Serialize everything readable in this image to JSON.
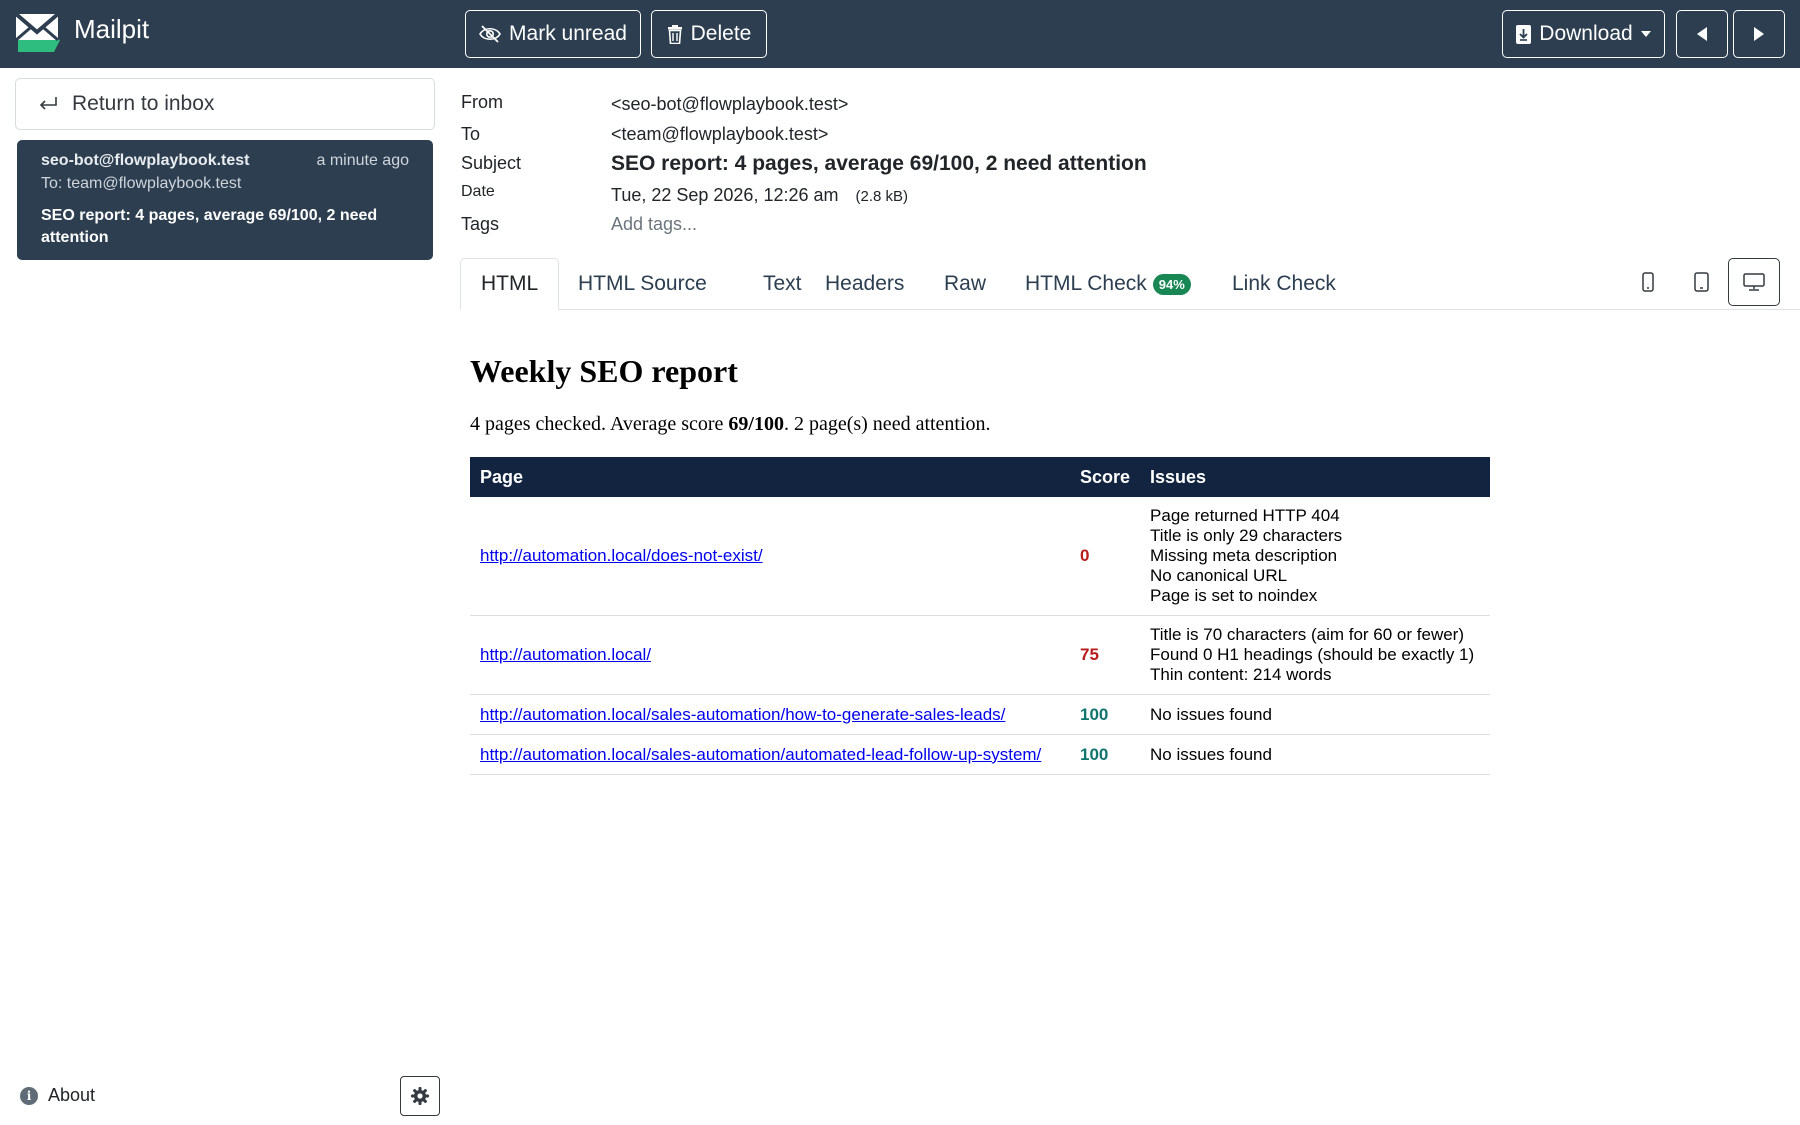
{
  "app": {
    "name": "Mailpit"
  },
  "toolbar": {
    "mark_unread": "Mark unread",
    "delete": "Delete",
    "download": "Download"
  },
  "sidebar": {
    "return_label": "Return to inbox",
    "message": {
      "from": "seo-bot@flowplaybook.test",
      "time": "a minute ago",
      "to": "To: team@flowplaybook.test",
      "subject": "SEO report: 4 pages, average 69/100, 2 need attention"
    },
    "about": "About"
  },
  "headers": {
    "from_label": "From",
    "from_value": "<seo-bot@flowplaybook.test>",
    "to_label": "To",
    "to_value": "<team@flowplaybook.test>",
    "subject_label": "Subject",
    "subject_value": "SEO report: 4 pages, average 69/100, 2 need attention",
    "date_label": "Date",
    "date_value": "Tue, 22 Sep 2026, 12:26 am",
    "size": "(2.8 kB)",
    "tags_label": "Tags",
    "tags_placeholder": "Add tags..."
  },
  "tabs": [
    {
      "label": "HTML"
    },
    {
      "label": "HTML Source"
    },
    {
      "label": "Text"
    },
    {
      "label": "Headers"
    },
    {
      "label": "Raw"
    },
    {
      "label": "HTML Check",
      "badge": "94%"
    },
    {
      "label": "Link Check"
    }
  ],
  "email": {
    "title": "Weekly SEO report",
    "summary_pre": "4 pages checked. Average score ",
    "summary_score": "69/100",
    "summary_post": ". 2 page(s) need attention.",
    "columns": [
      "Page",
      "Score",
      "Issues"
    ],
    "rows": [
      {
        "url": "http://automation.local/does-not-exist/",
        "score": "0",
        "score_color": "#b91c1c",
        "issues": [
          "Page returned HTTP 404",
          "Title is only 29 characters",
          "Missing meta description",
          "No canonical URL",
          "Page is set to noindex"
        ]
      },
      {
        "url": "http://automation.local/",
        "score": "75",
        "score_color": "#b91c1c",
        "issues": [
          "Title is 70 characters (aim for 60 or fewer)",
          "Found 0 H1 headings (should be exactly 1)",
          "Thin content: 214 words"
        ]
      },
      {
        "url": "http://automation.local/sales-automation/how-to-generate-sales-leads/",
        "score": "100",
        "score_color": "#0f766e",
        "issues": [
          "No issues found"
        ]
      },
      {
        "url": "http://automation.local/sales-automation/automated-lead-follow-up-system/",
        "score": "100",
        "score_color": "#0f766e",
        "issues": [
          "No issues found"
        ]
      }
    ]
  },
  "colors": {
    "topbar": "#2c3e50",
    "table_header": "#12243f",
    "badge": "#198754"
  }
}
